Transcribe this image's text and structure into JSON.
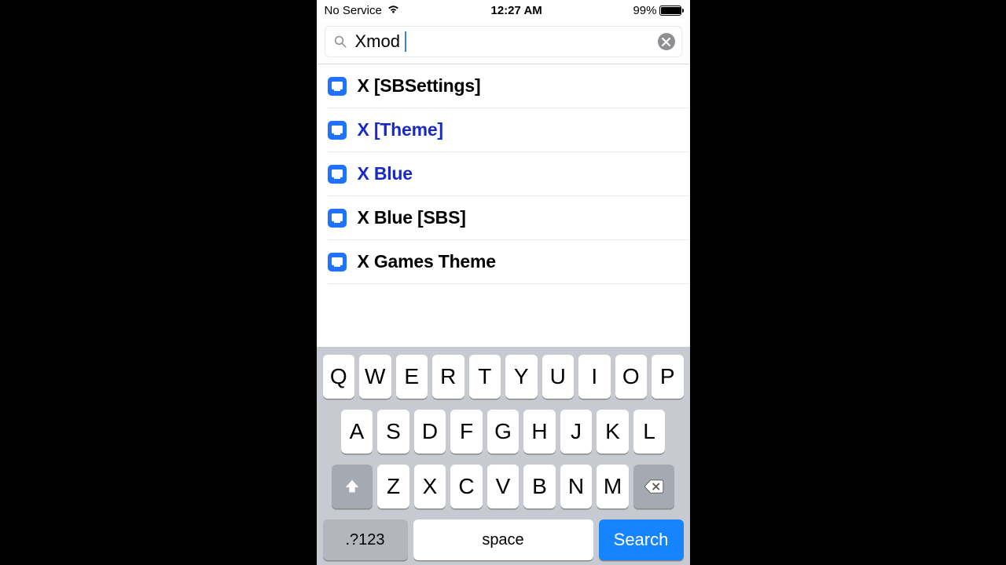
{
  "status": {
    "carrier": "No Service",
    "time": "12:27 AM",
    "battery_pct": "99%"
  },
  "search": {
    "query": "Xmod"
  },
  "results": [
    {
      "label": "X [SBSettings]",
      "visited": false
    },
    {
      "label": "X [Theme]",
      "visited": true
    },
    {
      "label": "X Blue",
      "visited": true
    },
    {
      "label": "X Blue [SBS]",
      "visited": false
    },
    {
      "label": "X Games Theme",
      "visited": false
    }
  ],
  "keyboard": {
    "row1": [
      "Q",
      "W",
      "E",
      "R",
      "T",
      "Y",
      "U",
      "I",
      "O",
      "P"
    ],
    "row2": [
      "A",
      "S",
      "D",
      "F",
      "G",
      "H",
      "J",
      "K",
      "L"
    ],
    "row3": [
      "Z",
      "X",
      "C",
      "V",
      "B",
      "N",
      "M"
    ],
    "numswitch": ".?123",
    "space": "space",
    "search": "Search"
  }
}
